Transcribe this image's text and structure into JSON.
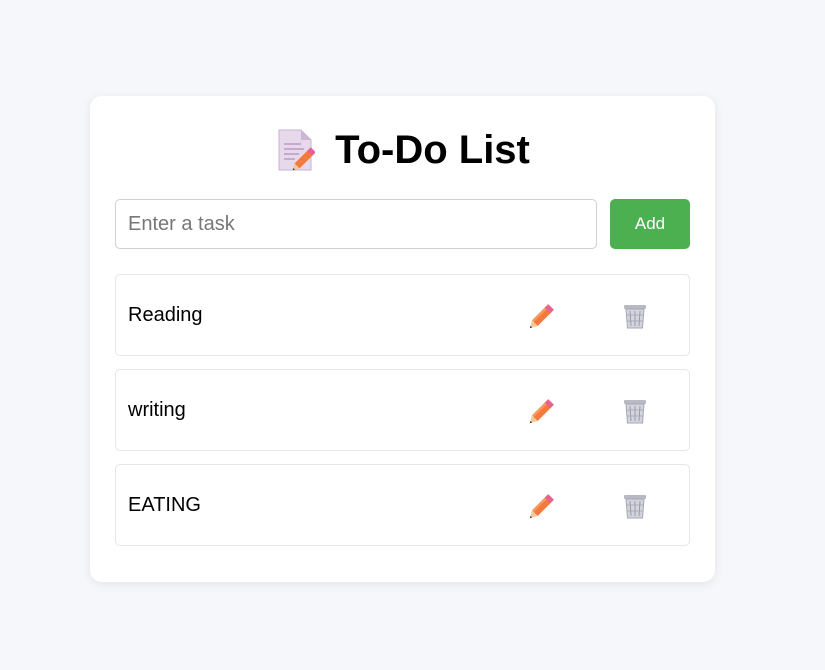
{
  "app": {
    "title": "To-Do List",
    "title_icon": "memo-icon"
  },
  "input": {
    "placeholder": "Enter a task",
    "value": ""
  },
  "add_button": {
    "label": "Add",
    "color": "#4caf50"
  },
  "tasks": [
    {
      "text": "Reading",
      "edit_icon": "pencil-icon",
      "delete_icon": "trash-icon"
    },
    {
      "text": "writing",
      "edit_icon": "pencil-icon",
      "delete_icon": "trash-icon"
    },
    {
      "text": "EATING",
      "edit_icon": "pencil-icon",
      "delete_icon": "trash-icon"
    }
  ]
}
